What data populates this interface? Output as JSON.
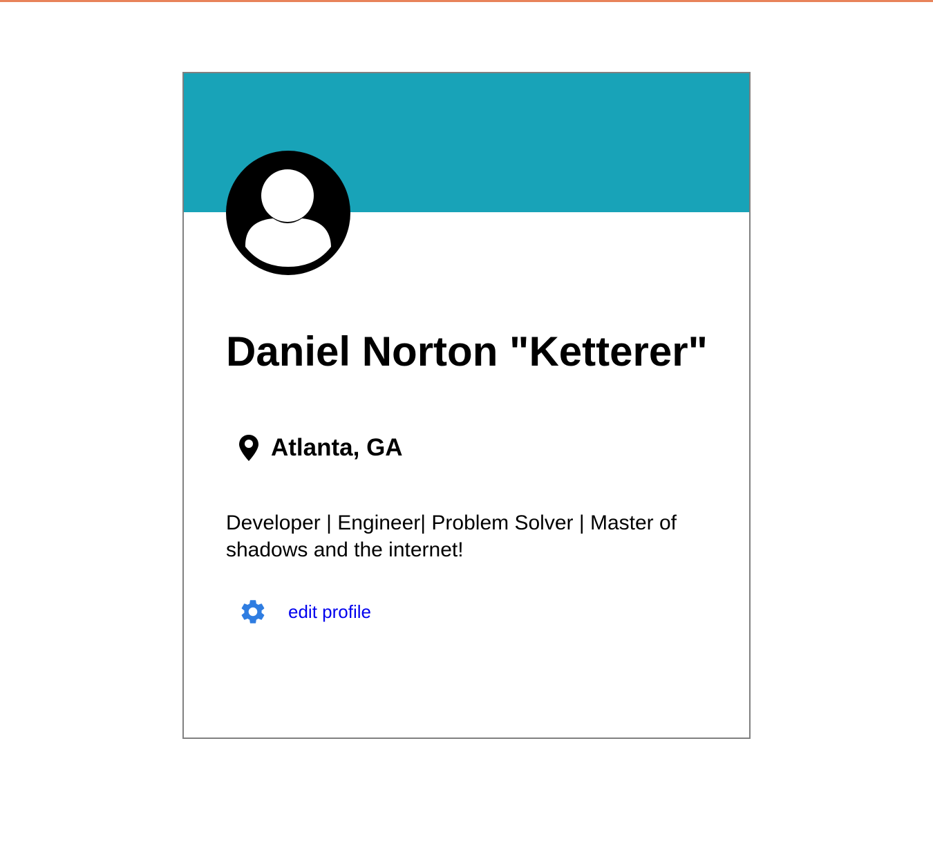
{
  "profile": {
    "name": "Daniel Norton \"Ketterer\"",
    "location": "Atlanta, GA",
    "bio": "Developer | Engineer| Problem Solver | Master of shadows and the internet!",
    "edit_label": "edit profile"
  },
  "icons": {
    "avatar": "user-circle-icon",
    "location": "map-pin-icon",
    "settings": "gear-icon"
  },
  "colors": {
    "banner": "#18a3b8",
    "link": "#0000ee",
    "gear": "#2f7de1",
    "card_border": "#808080",
    "top_accent": "#e8835a"
  }
}
